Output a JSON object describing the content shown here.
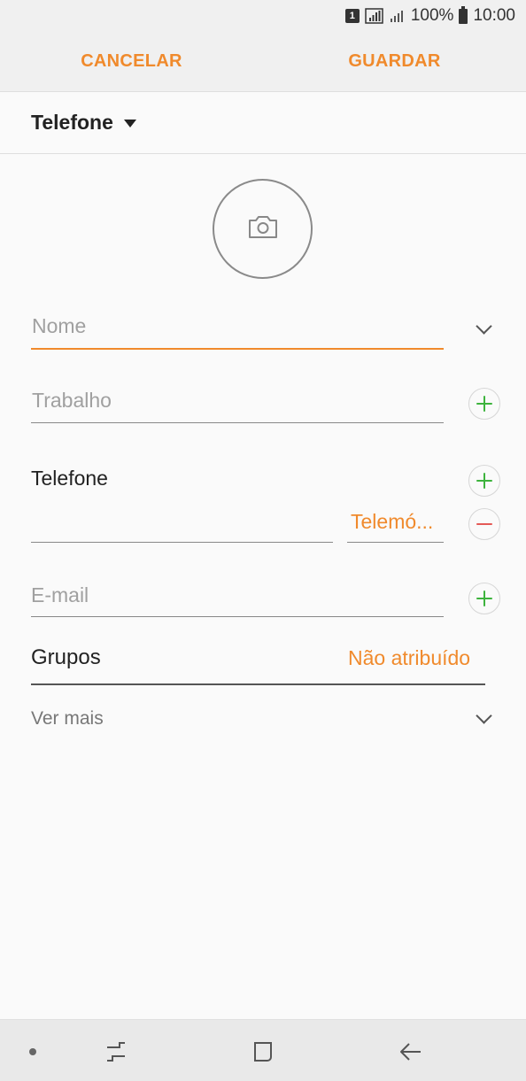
{
  "status_bar": {
    "sim": "1",
    "battery": "100%",
    "time": "10:00",
    "icons": [
      "sim-icon",
      "signal-icon",
      "signal-icon",
      "battery-icon"
    ]
  },
  "toolbar": {
    "cancel_label": "CANCELAR",
    "save_label": "GUARDAR",
    "accent": "#f08a2c"
  },
  "storage": {
    "selected": "Telefone",
    "icon": "dropdown-triangle-icon"
  },
  "photo": {
    "icon": "camera-icon"
  },
  "form": {
    "name": {
      "placeholder": "Nome",
      "value": ""
    },
    "work": {
      "placeholder": "Trabalho",
      "value": ""
    },
    "phone": {
      "label": "Telefone",
      "number_value": "",
      "type": "Telemó..."
    },
    "email": {
      "placeholder": "E-mail",
      "value": ""
    },
    "groups": {
      "label": "Grupos",
      "value": "Não atribuído"
    },
    "more": {
      "label": "Ver mais"
    }
  },
  "colors": {
    "add": "#3db33d",
    "remove": "#e45a57"
  },
  "nav_bar": {
    "icons": [
      "dot-icon",
      "recent-apps-icon",
      "home-icon",
      "back-icon"
    ]
  }
}
